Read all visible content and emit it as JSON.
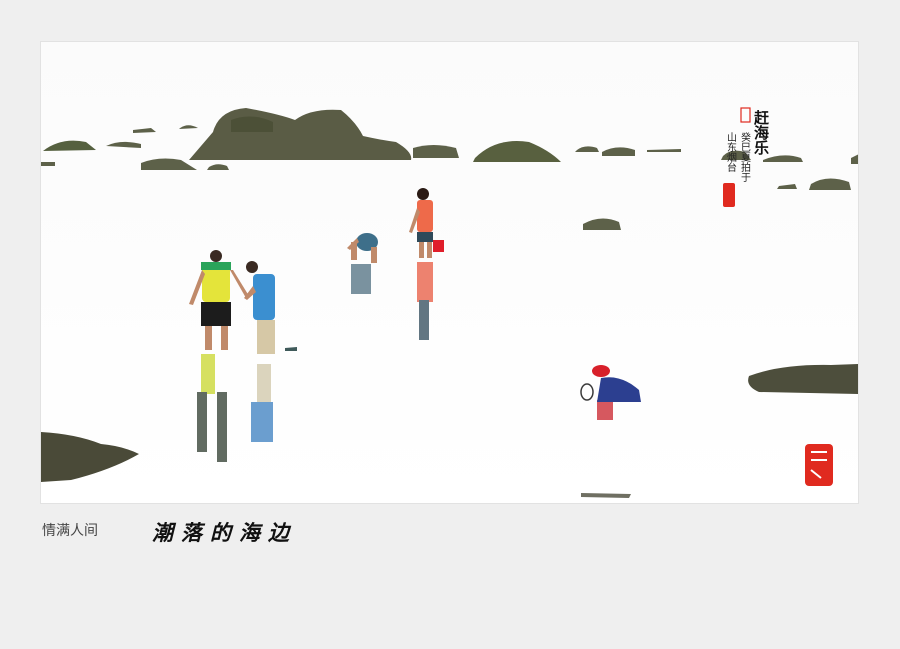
{
  "caption": {
    "left_text": "情满人间",
    "title": "潮落的海边"
  },
  "photo": {
    "calligraphy_title": "赶海乐",
    "calligraphy_note_1": "癸巳夏拍于",
    "calligraphy_note_2": "山东烟台"
  },
  "colors": {
    "page_bg": "#efefef",
    "photo_bg": "#ffffff",
    "seal_red": "#e02a1f"
  }
}
